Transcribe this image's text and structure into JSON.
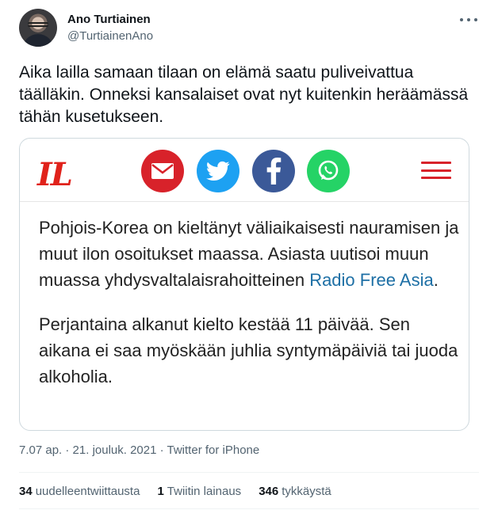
{
  "author": {
    "name": "Ano Turtiainen",
    "handle": "@TurtiainenAno"
  },
  "tweet": {
    "text": "Aika lailla samaan tilaan on elämä saatu puliveivattua täälläkin. Onneksi kansalaiset ovat nyt kuitenkin heräämässä tähän kusetukseen."
  },
  "card": {
    "logo": "IL",
    "share_icons": [
      "mail-icon",
      "twitter-icon",
      "facebook-icon",
      "whatsapp-icon"
    ],
    "para1_a": "Pohjois-Korea on kieltänyt väliaikaisesti nauramisen ja muut ilon osoitukset maassa. Asiasta uutisoi muun muassa yhdysvaltalaisrahoitteinen ",
    "para1_link": "Radio Free Asia",
    "para1_b": ".",
    "para2": "Perjantaina alkanut kielto kestää 11 päivää. Sen aikana ei saa myöskään juhlia syntymäpäiviä tai juoda alkoholia."
  },
  "meta": {
    "timestamp": "7.07 ap. · 21. jouluk. 2021 · Twitter for iPhone"
  },
  "stats": {
    "retweets_count": "34",
    "retweets_label": "uudelleentwiittausta",
    "quotes_count": "1",
    "quotes_label": "Twiitin lainaus",
    "likes_count": "346",
    "likes_label": "tykkäystä"
  },
  "colors": {
    "accent": "#1d9bf0",
    "brand_red": "#d8222a",
    "link": "#1d6fa5"
  }
}
